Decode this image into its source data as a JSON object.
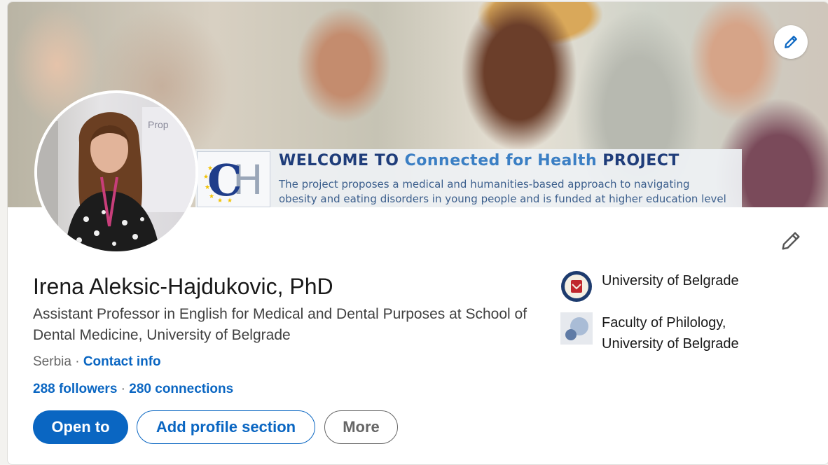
{
  "banner": {
    "title_prefix": "WELCOME TO",
    "title_accent": "Connected for Health",
    "title_suffix": "PROJECT",
    "description_line1": "The project proposes a medical and humanities-based approach to navigating",
    "description_line2": "obesity and eating disorders in young people and is funded at higher education level",
    "logo_text_c": "C",
    "logo_text_h": "H",
    "logo_stars": "★"
  },
  "profile": {
    "name": "Irena Aleksic-Hajdukovic, PhD",
    "headline": "Assistant Professor in English for Medical and Dental Purposes at School of Dental Medicine, University of Belgrade",
    "location": "Serbia",
    "separator": " · ",
    "contact_info": "Contact info",
    "followers": "288 followers",
    "connections": "280 connections",
    "avatar_sign_text": "Prop"
  },
  "actions": {
    "open_to": "Open to",
    "add_profile_section": "Add profile section",
    "more": "More"
  },
  "organizations": [
    {
      "name": "University of Belgrade",
      "icon": "university-seal-icon"
    },
    {
      "name": "Faculty of Philology, University of Belgrade",
      "icon": "faculty-logo-icon"
    }
  ],
  "colors": {
    "brand": "#0a66c2",
    "text_primary": "#191919",
    "text_secondary": "#666666",
    "background": "#f3f2ef"
  }
}
